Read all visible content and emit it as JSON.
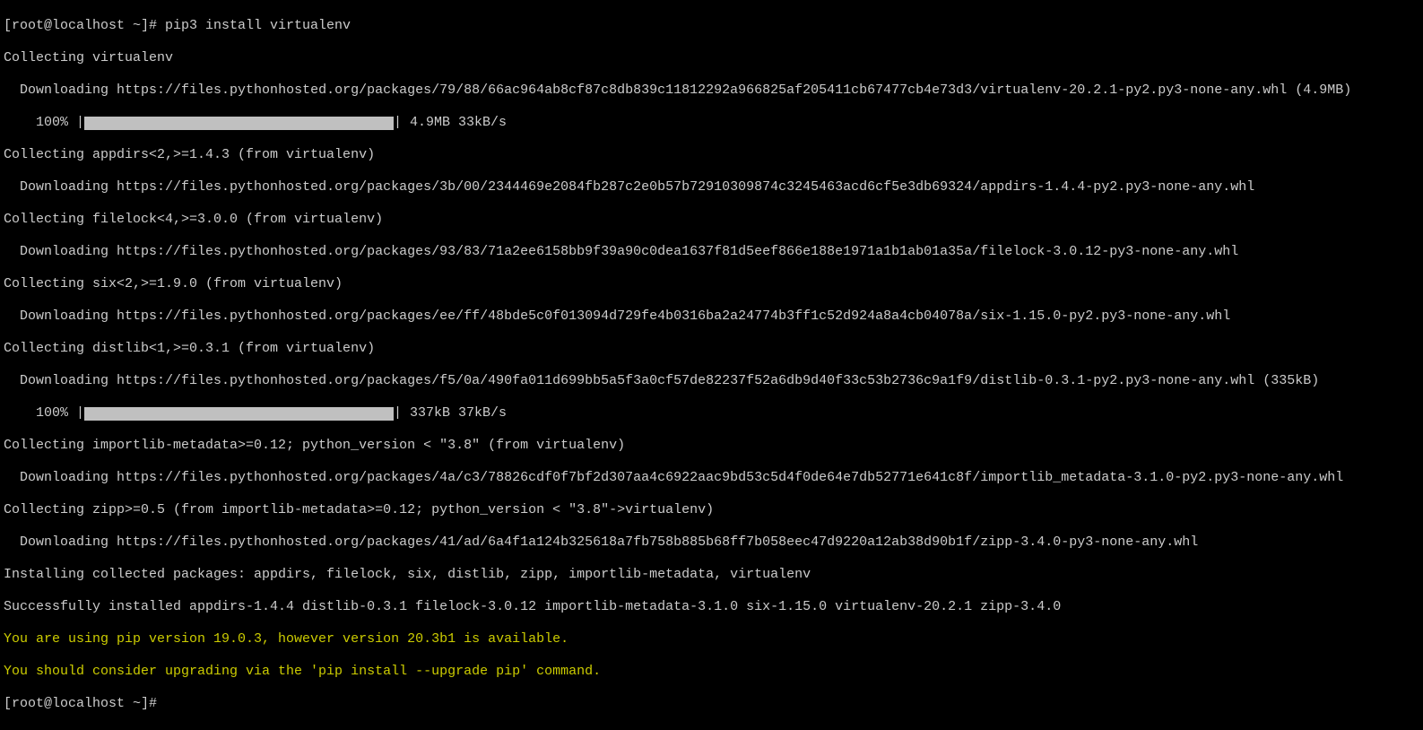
{
  "prompt1": "[root@localhost ~]# pip3 install virtualenv",
  "l1": "Collecting virtualenv",
  "l2": "  Downloading https://files.pythonhosted.org/packages/79/88/66ac964ab8cf87c8db839c11812292a966825af205411cb67477cb4e73d3/virtualenv-20.2.1-py2.py3-none-any.whl (4.9MB)",
  "prog1_left": "    100% |",
  "prog1_right": "| 4.9MB 33kB/s",
  "l3": "Collecting appdirs<2,>=1.4.3 (from virtualenv)",
  "l4": "  Downloading https://files.pythonhosted.org/packages/3b/00/2344469e2084fb287c2e0b57b72910309874c3245463acd6cf5e3db69324/appdirs-1.4.4-py2.py3-none-any.whl",
  "l5": "Collecting filelock<4,>=3.0.0 (from virtualenv)",
  "l6": "  Downloading https://files.pythonhosted.org/packages/93/83/71a2ee6158bb9f39a90c0dea1637f81d5eef866e188e1971a1b1ab01a35a/filelock-3.0.12-py3-none-any.whl",
  "l7": "Collecting six<2,>=1.9.0 (from virtualenv)",
  "l8": "  Downloading https://files.pythonhosted.org/packages/ee/ff/48bde5c0f013094d729fe4b0316ba2a24774b3ff1c52d924a8a4cb04078a/six-1.15.0-py2.py3-none-any.whl",
  "l9": "Collecting distlib<1,>=0.3.1 (from virtualenv)",
  "l10": "  Downloading https://files.pythonhosted.org/packages/f5/0a/490fa011d699bb5a5f3a0cf57de82237f52a6db9d40f33c53b2736c9a1f9/distlib-0.3.1-py2.py3-none-any.whl (335kB)",
  "prog2_left": "    100% |",
  "prog2_right": "| 337kB 37kB/s",
  "l11": "Collecting importlib-metadata>=0.12; python_version < \"3.8\" (from virtualenv)",
  "l12": "  Downloading https://files.pythonhosted.org/packages/4a/c3/78826cdf0f7bf2d307aa4c6922aac9bd53c5d4f0de64e7db52771e641c8f/importlib_metadata-3.1.0-py2.py3-none-any.whl",
  "l13": "Collecting zipp>=0.5 (from importlib-metadata>=0.12; python_version < \"3.8\"->virtualenv)",
  "l14": "  Downloading https://files.pythonhosted.org/packages/41/ad/6a4f1a124b325618a7fb758b885b68ff7b058eec47d9220a12ab38d90b1f/zipp-3.4.0-py3-none-any.whl",
  "l15": "Installing collected packages: appdirs, filelock, six, distlib, zipp, importlib-metadata, virtualenv",
  "l16": "Successfully installed appdirs-1.4.4 distlib-0.3.1 filelock-3.0.12 importlib-metadata-3.1.0 six-1.15.0 virtualenv-20.2.1 zipp-3.4.0",
  "warn1": "You are using pip version 19.0.3, however version 20.3b1 is available.",
  "warn2": "You should consider upgrading via the 'pip install --upgrade pip' command.",
  "prompt2": "[root@localhost ~]#"
}
